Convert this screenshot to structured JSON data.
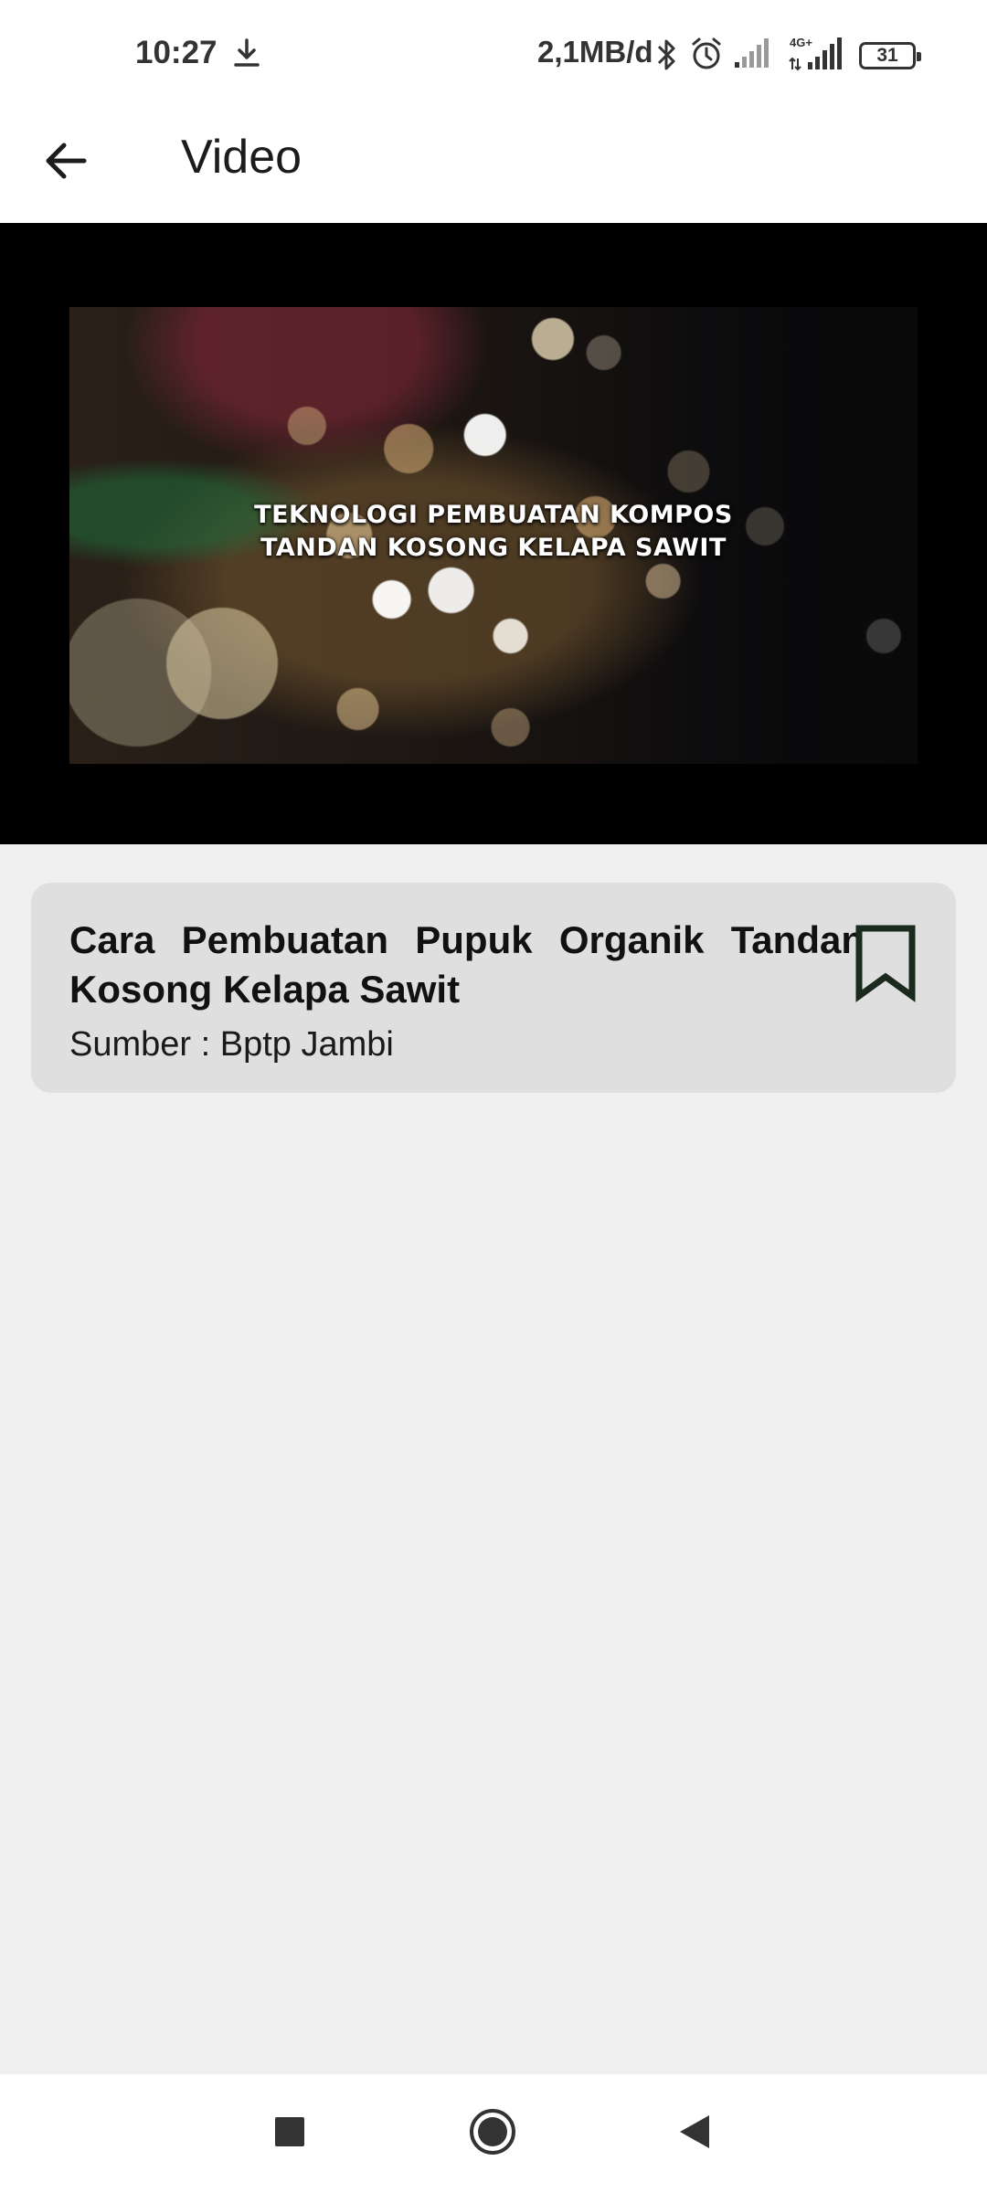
{
  "status_bar": {
    "time": "10:27",
    "network_speed": "2,1MB/d",
    "network_type": "4G+",
    "battery": "31",
    "icons": [
      "download-icon",
      "bluetooth-icon",
      "alarm-icon",
      "signal-icon",
      "signal-4g-icon",
      "battery-icon"
    ]
  },
  "app_bar": {
    "title": "Video",
    "back_icon": "arrow-left-icon"
  },
  "video": {
    "caption_line1": "TEKNOLOGI PEMBUATAN KOMPOS",
    "caption_line2": "TANDAN KOSONG KELAPA SAWIT"
  },
  "card": {
    "title": "Cara Pembuatan Pupuk Organik Tandan Kosong Kelapa Sawit",
    "source": "Sumber : Bptp Jambi",
    "bookmark_icon": "bookmark-outline-icon"
  },
  "nav_bar": {
    "buttons": [
      "recents-square-icon",
      "home-circle-icon",
      "back-triangle-icon"
    ]
  },
  "colors": {
    "card_background": "#dfdfdf",
    "page_background": "#f0f0f0",
    "bookmark_stroke": "#1a2a1c"
  }
}
